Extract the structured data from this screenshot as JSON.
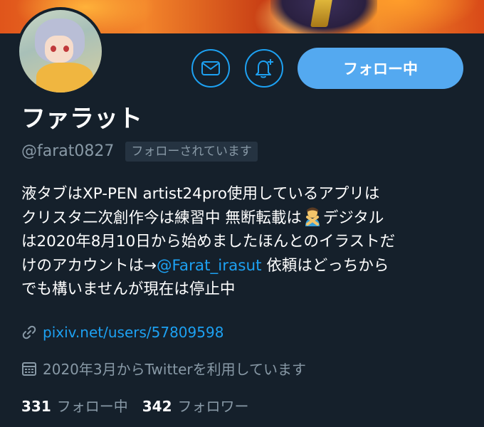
{
  "profile": {
    "display_name": "ファラット",
    "handle": "@farat0827",
    "follows_you_label": "フォローされています",
    "bio": {
      "lines": [
        "液タブはXP-PEN artist24pro使用しているアプリは",
        "クリスタ二次創作今は練習中 無断転載は",
        "デジタル",
        "は2020年8月10日から始めましたほんとのイラストだ",
        "けのアカウントは→",
        "@Farat_irasut",
        " 依頼はどっちから",
        "でも構いませんが現在は停止中"
      ]
    },
    "link": "pixiv.net/users/57809598",
    "joined": "2020年3月からTwitterを利用しています",
    "following_count": "331",
    "following_label": "フォロー中",
    "followers_count": "342",
    "followers_label": "フォロワー"
  },
  "actions": {
    "follow_button_label": "フォロー中",
    "message_icon": "mail-icon",
    "notify_icon": "bell-plus-icon"
  },
  "colors": {
    "background": "#15202b",
    "accent": "#1da1f2",
    "follow_button": "#54a9f0",
    "muted": "#8899a6"
  }
}
